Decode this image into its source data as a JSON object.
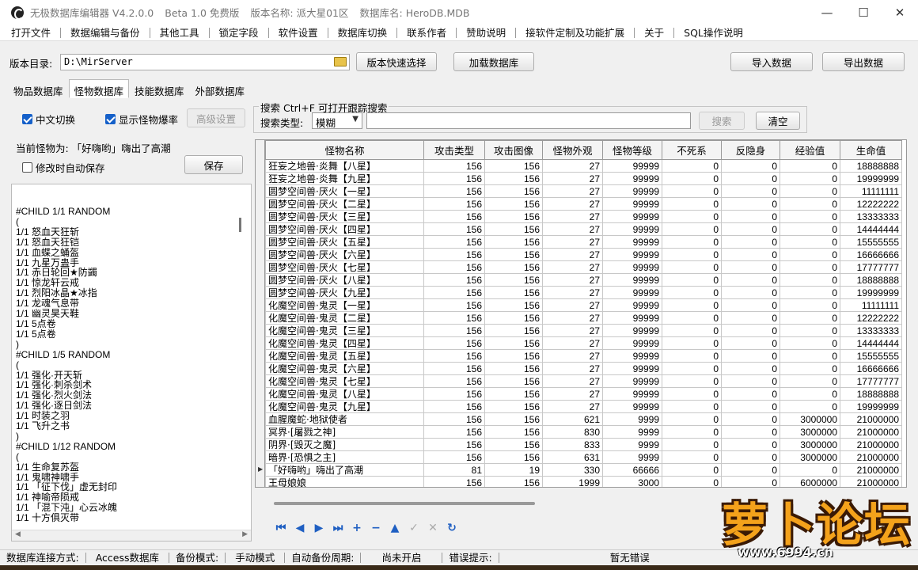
{
  "window": {
    "title_segments": [
      "无极数据库编辑器 V4.2.0.0",
      "Beta 1.0 免费版",
      "版本名称: 派大星01区",
      "数据库名: HeroDB.MDB"
    ],
    "controls": [
      "—",
      "☐",
      "✕"
    ]
  },
  "menu": [
    "打开文件",
    "数据编辑与备份",
    "其他工具",
    "锁定字段",
    "软件设置",
    "数据库切换",
    "联系作者",
    "赞助说明",
    "接软件定制及功能扩展",
    "关于",
    "SQL操作说明"
  ],
  "toolbar": {
    "version_dir_label": "版本目录:",
    "version_dir_value": "D:\\MirServer",
    "quick_select_label": "版本快速选择",
    "load_db_label": "加载数据库",
    "import_label": "导入数据",
    "export_label": "导出数据"
  },
  "tabs": [
    {
      "label": "物品数据库",
      "active": false
    },
    {
      "label": "怪物数据库",
      "active": true
    },
    {
      "label": "技能数据库",
      "active": false
    },
    {
      "label": "外部数据库",
      "active": false
    }
  ],
  "options": {
    "chinese_switch": "中文切换",
    "chinese_switch_checked": true,
    "show_drops": "显示怪物爆率",
    "show_drops_checked": true,
    "advanced": "高级设置"
  },
  "search": {
    "title": "搜索  Ctrl+F 可打开跟踪搜索",
    "type_label": "搜索类型:",
    "type_value": "模糊",
    "query": "",
    "search_label": "搜索",
    "clear_label": "清空"
  },
  "left": {
    "current_monster": "当前怪物为: 「好嗨哟」嗨出了高潮",
    "autosave_label": "修改时自动保存",
    "autosave_checked": false,
    "save_label": "保存",
    "drop_lines": [
      "#CHILD 1/1 RANDOM",
      "(",
      "1/1 怒血天狂斩",
      "1/1 怒血天狂铠",
      "1/1 血蝶之蛹盔",
      "1/1 九星万蛊手",
      "1/1 赤日轮回★防蠲",
      "1/1 惊龙轩云戒",
      "1/1 烈阳冰晶★冰指",
      "1/1 龙魂气息带",
      "1/1 幽灵昊天鞋",
      "1/1 5点卷",
      "1/1 5点卷",
      ")",
      "#CHILD 1/5 RANDOM",
      "(",
      "1/1 强化·开天斩",
      "1/1 强化·刺杀剑术",
      "1/1 强化·烈火剑法",
      "1/1 强化·逐日剑法",
      "1/1 时装之羽",
      "1/1 飞升之书",
      ")",
      "#CHILD 1/12 RANDOM",
      "(",
      "1/1 生命复苏盔",
      "1/1 鬼啸神啸手",
      "1/1 「征下伐」虚无封印",
      "1/1 神喻帝陨戒",
      "1/1 「混下沌」心云冰魄",
      "1/1 十方俱灭带"
    ]
  },
  "grid": {
    "columns": [
      "怪物名称",
      "攻击类型",
      "攻击图像",
      "怪物外观",
      "怪物等级",
      "不死系",
      "反隐身",
      "经验值",
      "生命值"
    ],
    "rows": [
      [
        "狂妄之地兽·炎舞【八星】",
        "156",
        "156",
        "27",
        "99999",
        "0",
        "0",
        "0",
        "18888888"
      ],
      [
        "狂妄之地兽·炎舞【九星】",
        "156",
        "156",
        "27",
        "99999",
        "0",
        "0",
        "0",
        "19999999"
      ],
      [
        "圆梦空间兽·厌火【一星】",
        "156",
        "156",
        "27",
        "99999",
        "0",
        "0",
        "0",
        "11111111"
      ],
      [
        "圆梦空间兽·厌火【二星】",
        "156",
        "156",
        "27",
        "99999",
        "0",
        "0",
        "0",
        "12222222"
      ],
      [
        "圆梦空间兽·厌火【三星】",
        "156",
        "156",
        "27",
        "99999",
        "0",
        "0",
        "0",
        "13333333"
      ],
      [
        "圆梦空间兽·厌火【四星】",
        "156",
        "156",
        "27",
        "99999",
        "0",
        "0",
        "0",
        "14444444"
      ],
      [
        "圆梦空间兽·厌火【五星】",
        "156",
        "156",
        "27",
        "99999",
        "0",
        "0",
        "0",
        "15555555"
      ],
      [
        "圆梦空间兽·厌火【六星】",
        "156",
        "156",
        "27",
        "99999",
        "0",
        "0",
        "0",
        "16666666"
      ],
      [
        "圆梦空间兽·厌火【七星】",
        "156",
        "156",
        "27",
        "99999",
        "0",
        "0",
        "0",
        "17777777"
      ],
      [
        "圆梦空间兽·厌火【八星】",
        "156",
        "156",
        "27",
        "99999",
        "0",
        "0",
        "0",
        "18888888"
      ],
      [
        "圆梦空间兽·厌火【九星】",
        "156",
        "156",
        "27",
        "99999",
        "0",
        "0",
        "0",
        "19999999"
      ],
      [
        "化魔空间兽·鬼灵【一星】",
        "156",
        "156",
        "27",
        "99999",
        "0",
        "0",
        "0",
        "11111111"
      ],
      [
        "化魔空间兽·鬼灵【二星】",
        "156",
        "156",
        "27",
        "99999",
        "0",
        "0",
        "0",
        "12222222"
      ],
      [
        "化魔空间兽·鬼灵【三星】",
        "156",
        "156",
        "27",
        "99999",
        "0",
        "0",
        "0",
        "13333333"
      ],
      [
        "化魔空间兽·鬼灵【四星】",
        "156",
        "156",
        "27",
        "99999",
        "0",
        "0",
        "0",
        "14444444"
      ],
      [
        "化魔空间兽·鬼灵【五星】",
        "156",
        "156",
        "27",
        "99999",
        "0",
        "0",
        "0",
        "15555555"
      ],
      [
        "化魔空间兽·鬼灵【六星】",
        "156",
        "156",
        "27",
        "99999",
        "0",
        "0",
        "0",
        "16666666"
      ],
      [
        "化魔空间兽·鬼灵【七星】",
        "156",
        "156",
        "27",
        "99999",
        "0",
        "0",
        "0",
        "17777777"
      ],
      [
        "化魔空间兽·鬼灵【八星】",
        "156",
        "156",
        "27",
        "99999",
        "0",
        "0",
        "0",
        "18888888"
      ],
      [
        "化魔空间兽·鬼灵【九星】",
        "156",
        "156",
        "27",
        "99999",
        "0",
        "0",
        "0",
        "19999999"
      ],
      [
        "血腥魔蛇·地狱使者",
        "156",
        "156",
        "621",
        "9999",
        "0",
        "0",
        "3000000",
        "21000000"
      ],
      [
        "冥界·[屠戮之神]",
        "156",
        "156",
        "830",
        "9999",
        "0",
        "0",
        "3000000",
        "21000000"
      ],
      [
        "阴界·[毁灭之魔]",
        "156",
        "156",
        "833",
        "9999",
        "0",
        "0",
        "3000000",
        "21000000"
      ],
      [
        "暗界·[恐惧之主]",
        "156",
        "156",
        "631",
        "9999",
        "0",
        "0",
        "3000000",
        "21000000"
      ],
      [
        "「好嗨哟」嗨出了高潮",
        "81",
        "19",
        "330",
        "66666",
        "0",
        "0",
        "0",
        "21000000"
      ],
      [
        "王母娘娘",
        "156",
        "156",
        "1999",
        "3000",
        "0",
        "0",
        "6000000",
        "21000000"
      ]
    ],
    "current_row": 24
  },
  "navigator": [
    {
      "name": "first-record-icon",
      "glyph": "⏮",
      "enabled": true
    },
    {
      "name": "prior-record-icon",
      "glyph": "◀",
      "enabled": true
    },
    {
      "name": "next-record-icon",
      "glyph": "▶",
      "enabled": true
    },
    {
      "name": "last-record-icon",
      "glyph": "⏭",
      "enabled": true
    },
    {
      "name": "insert-record-icon",
      "glyph": "+",
      "enabled": true
    },
    {
      "name": "delete-record-icon",
      "glyph": "−",
      "enabled": true
    },
    {
      "name": "edit-record-icon",
      "glyph": "▲",
      "enabled": true
    },
    {
      "name": "post-record-icon",
      "glyph": "✓",
      "enabled": false
    },
    {
      "name": "cancel-record-icon",
      "glyph": "✕",
      "enabled": false
    },
    {
      "name": "refresh-record-icon",
      "glyph": "↻",
      "enabled": true
    }
  ],
  "status": {
    "conn_label": "数据库连接方式:",
    "conn_value": "Access数据库",
    "backup_label": "备份模式:",
    "backup_value": "手动模式",
    "autobackup_label": "自动备份周期:",
    "autobackup_value": "尚未开启",
    "error_label": "错误提示:",
    "error_value": "暂无错误"
  },
  "watermark": {
    "logo": "萝卜论坛",
    "url": "www.6994.cn"
  },
  "colors": {
    "accent": "#1560c9",
    "watermark": "#f4a21b"
  }
}
